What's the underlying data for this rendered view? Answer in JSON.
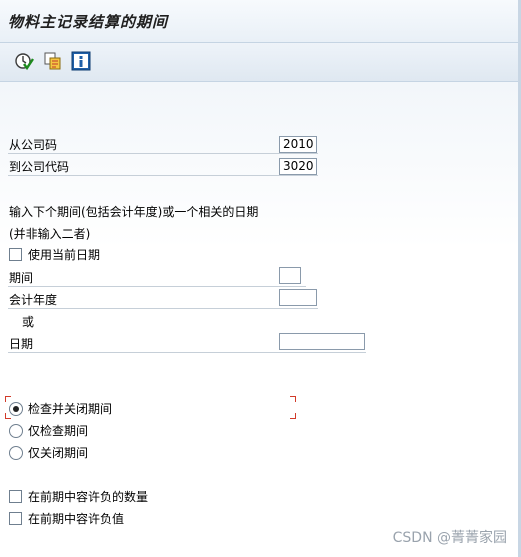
{
  "window": {
    "title": "物料主记录结算的期间"
  },
  "toolbar": {
    "icons": [
      "execute-icon",
      "copy-variant-icon",
      "info-icon"
    ]
  },
  "form": {
    "from_company_code": {
      "label": "从公司码",
      "value": "2010"
    },
    "to_company_code": {
      "label": "到公司代码",
      "value": "3020"
    },
    "instruction_line1": "输入下个期间(包括会计年度)或一个相关的日期",
    "instruction_line2": "(并非输入二者)",
    "use_current_date": {
      "label": "使用当前日期",
      "checked": false
    },
    "period": {
      "label": "期间",
      "value": ""
    },
    "fiscal_year": {
      "label": "会计年度",
      "value": ""
    },
    "or_text": "或",
    "date": {
      "label": "日期",
      "value": ""
    }
  },
  "options": {
    "check_and_close": {
      "label": "检查并关闭期间",
      "selected": true
    },
    "check_only": {
      "label": "仅检查期间",
      "selected": false
    },
    "close_only": {
      "label": "仅关闭期间",
      "selected": false
    }
  },
  "negatives": {
    "allow_negative_qty": {
      "label": "在前期中容许负的数量",
      "checked": false
    },
    "allow_negative_value": {
      "label": "在前期中容许负值",
      "checked": false
    }
  },
  "watermark": "CSDN @菁菁家园"
}
